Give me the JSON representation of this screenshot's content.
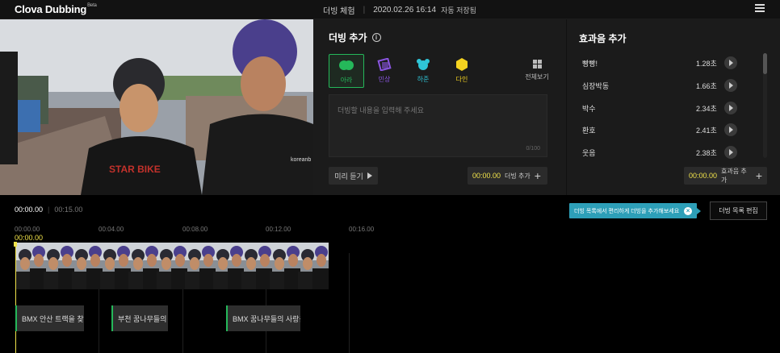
{
  "topbar": {
    "logo": "Clova Dubbing",
    "beta": "Beta",
    "mode": "더빙 체험",
    "datetime": "2020.02.26 16:14",
    "save_status": "자동 저장됨"
  },
  "dubbing": {
    "title": "더빙 추가",
    "voices": [
      {
        "label": "아라",
        "color": "#25b85a"
      },
      {
        "label": "민상",
        "color": "#8a55e0"
      },
      {
        "label": "하준",
        "color": "#2fc6d8"
      },
      {
        "label": "다인",
        "color": "#f5d320"
      }
    ],
    "all_voices": "전체보기",
    "placeholder": "더빙할 내용을 입력해 주세요",
    "char_count": "0/100",
    "preview": "미리 듣기",
    "time": "00:00.00",
    "add": "더빙 추가"
  },
  "sfx": {
    "title": "효과음 추가",
    "items": [
      {
        "name": "빵빵!",
        "duration": "1.28초"
      },
      {
        "name": "심장박동",
        "duration": "1.66초"
      },
      {
        "name": "박수",
        "duration": "2.34초"
      },
      {
        "name": "환호",
        "duration": "2.41초"
      },
      {
        "name": "웃음",
        "duration": "2.38초"
      }
    ],
    "time": "00:00.00",
    "add": "효과음 추가"
  },
  "timeline": {
    "current": "00:00.00",
    "total": "00:15.00",
    "ticks": [
      "00:00.00",
      "00:04.00",
      "00:08.00",
      "00:12.00",
      "00:16.00"
    ],
    "playhead": "00:00.00",
    "tip": "더빙 목록에서 편리하게 더빙을 추가해보세요",
    "edit_list": "더빙 목록 편집",
    "clips": [
      {
        "text": "BMX 안산 트랙을 찾은 "
      },
      {
        "text": "부천 꿈나무들의 파"
      },
      {
        "text": "BMX 꿈나무들의 사랑을 "
      }
    ]
  },
  "colors": {
    "accent_green": "#25b85a",
    "time_yellow": "#f0e24a",
    "tip_blue": "#2d9fb8"
  }
}
